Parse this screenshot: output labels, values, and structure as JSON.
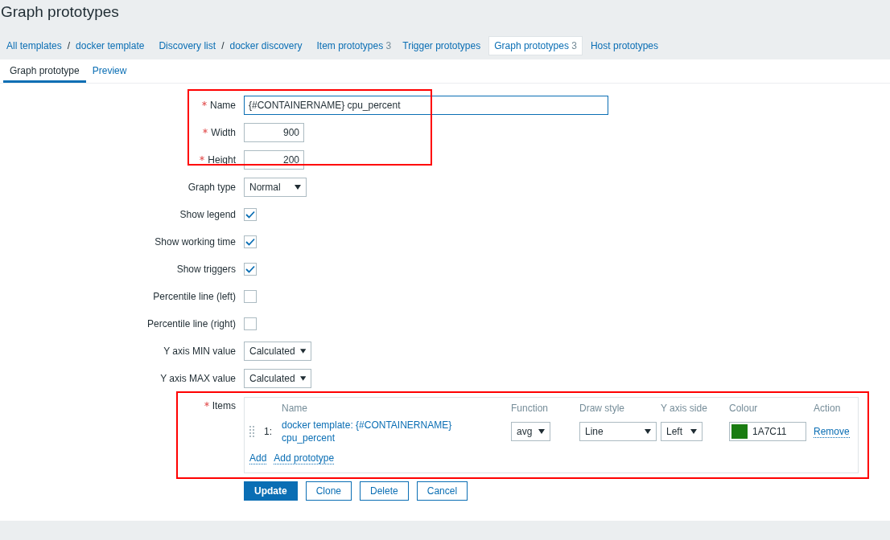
{
  "page_title": "Graph prototypes",
  "nav": [
    {
      "label": "All templates",
      "kind": "crumb",
      "separator": "/",
      "selected": false
    },
    {
      "label": "docker template",
      "kind": "crumb-end",
      "selected": false
    },
    {
      "label": "Discovery list",
      "kind": "crumb",
      "separator": "/",
      "selected": false
    },
    {
      "label": "docker discovery",
      "kind": "crumb-end",
      "selected": false
    },
    {
      "label": "Item prototypes",
      "kind": "tab",
      "count": "3",
      "selected": false
    },
    {
      "label": "Trigger prototypes",
      "kind": "tab",
      "selected": false
    },
    {
      "label": "Graph prototypes",
      "kind": "tab",
      "count": "3",
      "selected": true
    },
    {
      "label": "Host prototypes",
      "kind": "tab",
      "selected": false
    }
  ],
  "tabs": [
    {
      "label": "Graph prototype",
      "selected": true
    },
    {
      "label": "Preview",
      "selected": false
    }
  ],
  "fields": [
    {
      "kind": "text",
      "label": "Name",
      "required": true,
      "value": "{#CONTAINERNAME} cpu_percent"
    },
    {
      "kind": "number",
      "label": "Width",
      "required": true,
      "value": "900"
    },
    {
      "kind": "number",
      "label": "Height",
      "required": true,
      "value": "200"
    },
    {
      "kind": "select",
      "label": "Graph type",
      "required": false,
      "value": "Normal"
    },
    {
      "kind": "checkbox",
      "label": "Show legend",
      "required": false,
      "checked": true
    },
    {
      "kind": "checkbox",
      "label": "Show working time",
      "required": false,
      "checked": true
    },
    {
      "kind": "checkbox",
      "label": "Show triggers",
      "required": false,
      "checked": true
    },
    {
      "kind": "checkbox",
      "label": "Percentile line (left)",
      "required": false,
      "checked": false
    },
    {
      "kind": "checkbox",
      "label": "Percentile line (right)",
      "required": false,
      "checked": false
    },
    {
      "kind": "select",
      "label": "Y axis MIN value",
      "required": false,
      "value": "Calculated"
    },
    {
      "kind": "select",
      "label": "Y axis MAX value",
      "required": false,
      "value": "Calculated"
    }
  ],
  "items": {
    "label": "Items",
    "required": true,
    "columns": [
      "Name",
      "Function",
      "Draw style",
      "Y axis side",
      "Colour",
      "Action"
    ],
    "rows": [
      {
        "index": "1:",
        "name": "docker template: {#CONTAINERNAME} cpu_percent",
        "function": "avg",
        "draw_style": "Line",
        "y_axis_side": "Left",
        "color": "#1a7c11",
        "colour_text": "1A7C11",
        "action": "Remove"
      }
    ],
    "links": [
      "Add",
      "Add prototype"
    ]
  },
  "buttons": [
    {
      "label": "Update",
      "kind": "primary"
    },
    {
      "label": "Clone",
      "kind": "secondary"
    },
    {
      "label": "Delete",
      "kind": "secondary"
    },
    {
      "label": "Cancel",
      "kind": "secondary"
    }
  ]
}
